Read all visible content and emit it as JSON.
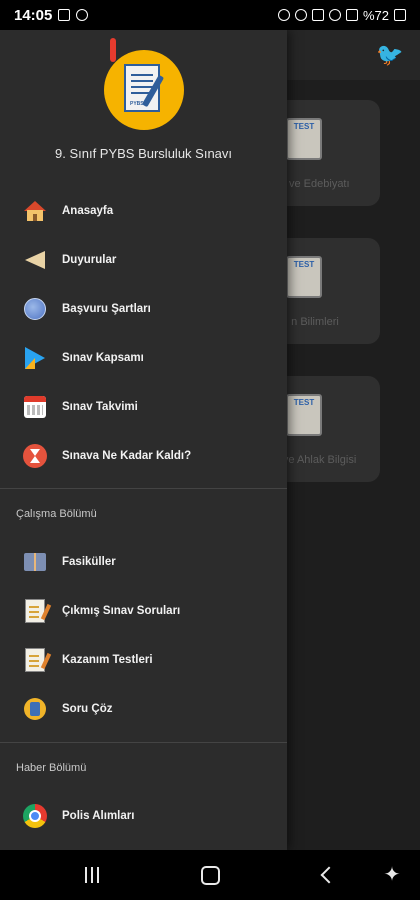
{
  "status": {
    "time": "14:05",
    "battery": "%72"
  },
  "background": {
    "cards": [
      {
        "label": "k ve Edebiyatı"
      },
      {
        "label": "n Bilimleri"
      },
      {
        "label": "ü ve Ahlak Bilgisi"
      }
    ],
    "test_badge": "TEST"
  },
  "drawer": {
    "title": "9. Sınıf PYBS Bursluluk Sınavı",
    "logo_badge": "PYBS",
    "items": [
      {
        "label": "Anasayfa",
        "icon": "home-icon"
      },
      {
        "label": "Duyurular",
        "icon": "megaphone-icon"
      },
      {
        "label": "Başvuru Şartları",
        "icon": "globe-icon"
      },
      {
        "label": "Sınav Kapsamı",
        "icon": "play-icon"
      },
      {
        "label": "Sınav Takvimi",
        "icon": "calendar-icon"
      },
      {
        "label": "Sınava Ne Kadar Kaldı?",
        "icon": "hourglass-icon"
      }
    ],
    "study_section": {
      "title": "Çalışma Bölümü",
      "items": [
        {
          "label": "Fasiküller",
          "icon": "book-icon"
        },
        {
          "label": "Çıkmış Sınav Soruları",
          "icon": "exam-paper-icon"
        },
        {
          "label": "Kazanım Testleri",
          "icon": "test-sheet-icon"
        },
        {
          "label": "Soru Çöz",
          "icon": "solve-icon"
        }
      ]
    },
    "news_section": {
      "title": "Haber Bölümü",
      "items": [
        {
          "label": "Polis Alımları",
          "icon": "chrome-icon"
        }
      ]
    }
  },
  "colors": {
    "drawer_bg": "#2c2c2c",
    "app_bg": "#1e1e1e",
    "logo_yellow": "#f6b300"
  }
}
